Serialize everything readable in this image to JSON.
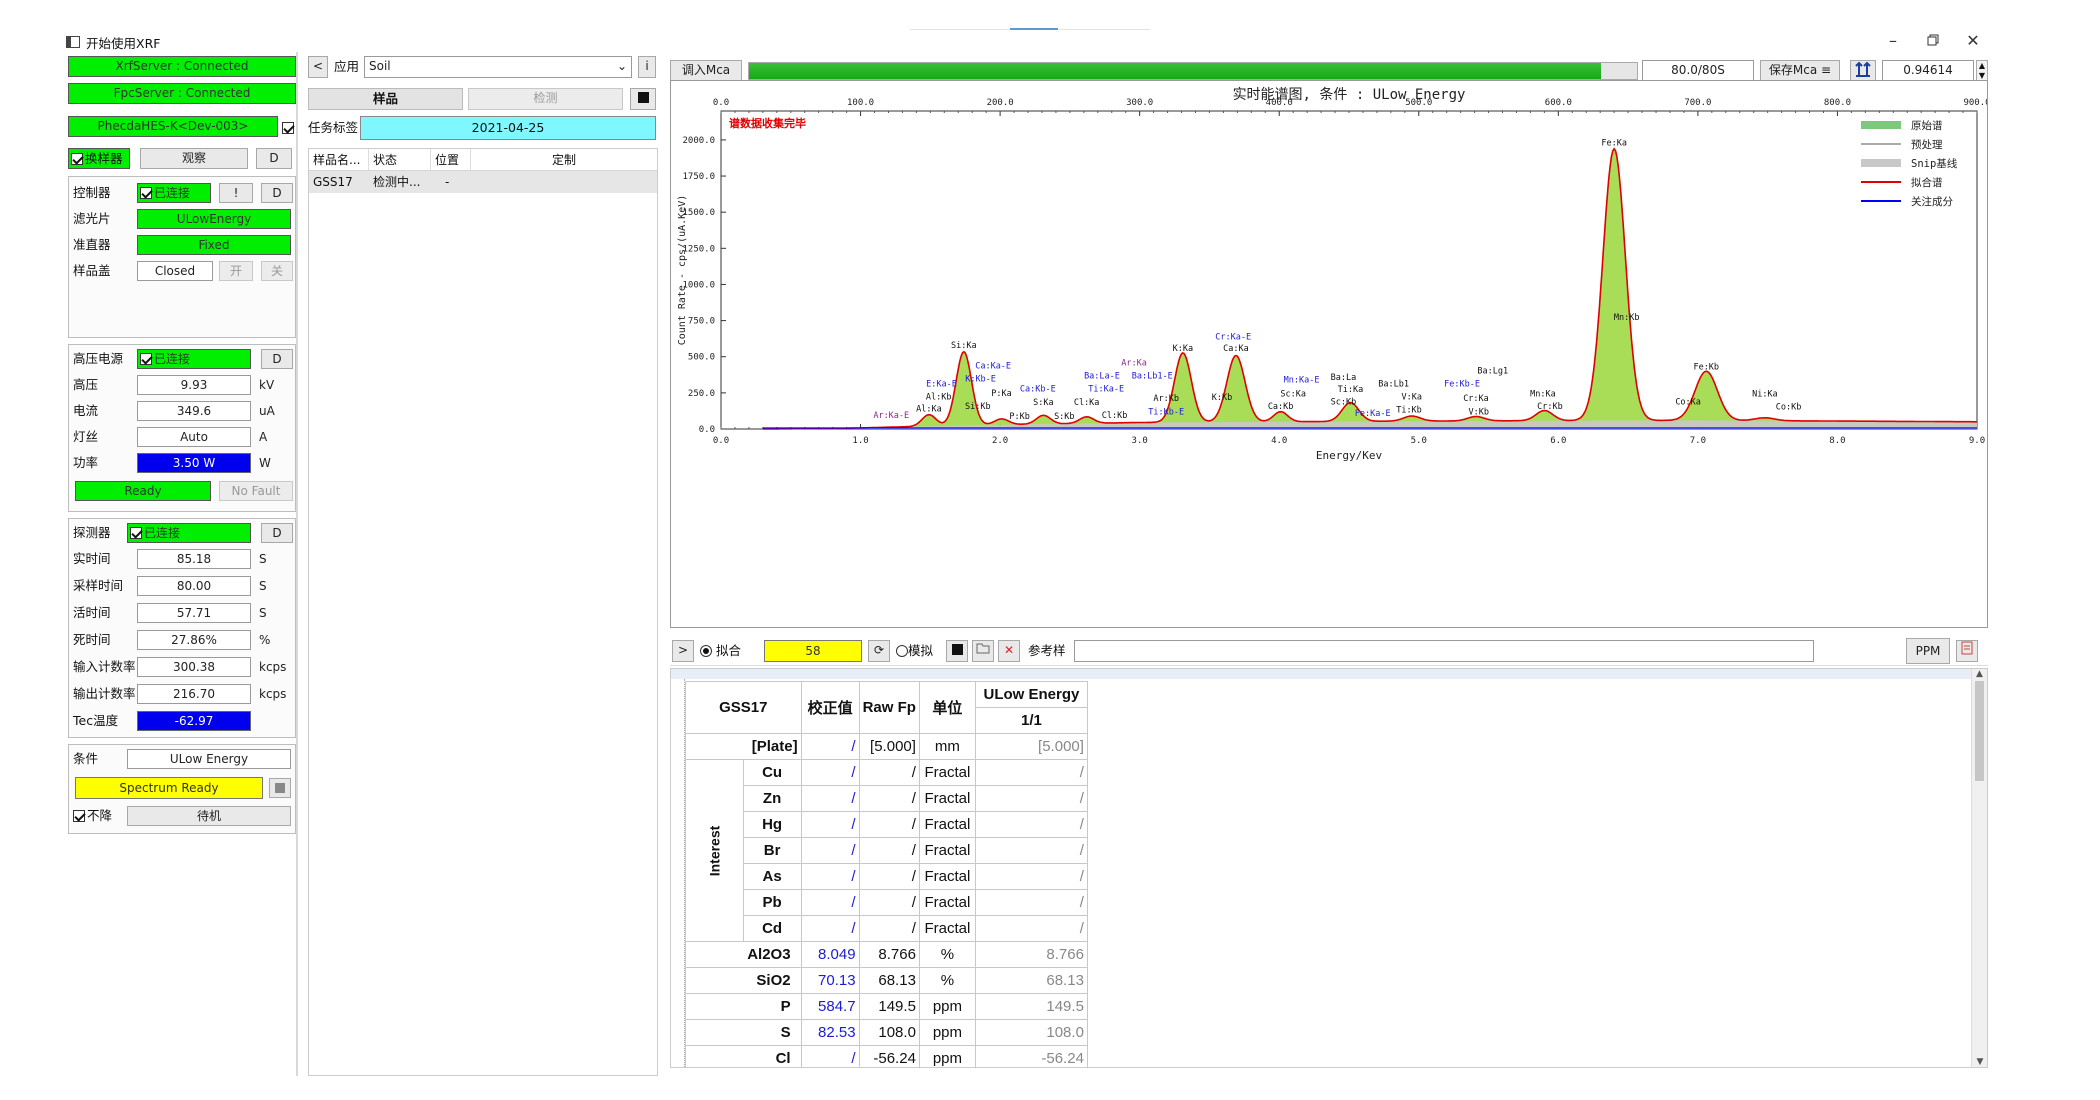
{
  "window": {
    "title": "开始使用XRF",
    "minimize_icon": "minimize-icon",
    "maximize_icon": "restore-icon",
    "close_icon": "close-icon"
  },
  "left": {
    "status": {
      "xrf": "XrfServer : Connected",
      "fpc": "FpcServer : Connected",
      "device": "PhecdaHES-K<Dev-003>"
    },
    "sample_changer": {
      "label": "换样器",
      "observe": "观察",
      "d": "D"
    },
    "controller": {
      "label": "控制器",
      "status": "已连接",
      "bang": "!",
      "d": "D"
    },
    "filter": {
      "label": "滤光片",
      "value": "ULowEnergy"
    },
    "collimator": {
      "label": "准直器",
      "value": "Fixed"
    },
    "sample_cover": {
      "label": "样品盖",
      "value": "Closed",
      "open": "开",
      "close": "关"
    },
    "hv": {
      "label": "高压电源",
      "status": "已连接",
      "d": "D"
    },
    "voltage": {
      "label": "高压",
      "value": "9.93",
      "unit": "kV"
    },
    "current": {
      "label": "电流",
      "value": "349.6",
      "unit": "uA"
    },
    "filament": {
      "label": "灯丝",
      "value": "Auto",
      "unit": "A"
    },
    "power": {
      "label": "功率",
      "value": "3.50 W",
      "unit": "W"
    },
    "ready": "Ready",
    "fault": "No Fault",
    "detector": {
      "label": "探测器",
      "status": "已连接",
      "d": "D"
    },
    "real_time": {
      "label": "实时间",
      "value": "85.18",
      "unit": "S"
    },
    "acq_time": {
      "label": "采样时间",
      "value": "80.00",
      "unit": "S"
    },
    "live_time": {
      "label": "活时间",
      "value": "57.71",
      "unit": "S"
    },
    "dead_time": {
      "label": "死时间",
      "value": "27.86%",
      "unit": "%"
    },
    "in_rate": {
      "label": "输入计数率",
      "value": "300.38",
      "unit": "kcps"
    },
    "out_rate": {
      "label": "输出计数率",
      "value": "216.70",
      "unit": "kcps"
    },
    "tec": {
      "label": "Tec温度",
      "value": "-62.97"
    },
    "condition": {
      "label": "条件",
      "value": "ULow Energy"
    },
    "spectrum_ready": "Spectrum Ready",
    "no_drop": "不降",
    "standby": "待机"
  },
  "middle": {
    "back": "<",
    "app_label": "应用",
    "app_value": "Soil",
    "info": "i",
    "sample_btn": "样品",
    "measure_btn": "检测",
    "task_label": "任务标签",
    "task_value": "2021-04-25",
    "columns": [
      "样品名...",
      "状态",
      "位置",
      "定制"
    ],
    "rows": [
      [
        "GSS17",
        "检测中...",
        "-",
        ""
      ]
    ]
  },
  "right": {
    "load_mca": "调入Mca",
    "progress": 0.96,
    "progress_text": "80.0/80S",
    "save_mca": "保存Mca",
    "save_mca_arrow": "≡",
    "value_box": "0.94614",
    "fit_label": "拟合",
    "fit_value": "58",
    "sim_label": "模拟",
    "ref_label": "参考样",
    "ppm": "PPM",
    "expand": ">"
  },
  "chart_data": {
    "type": "line",
    "title": "实时能谱图, 条件 : ULow Energy",
    "status_text": "谱数据收集完毕",
    "xlabel": "Energy/Kev",
    "ylabel": "Count Rate - cps/(uA.KeV)",
    "xlim": [
      0,
      9
    ],
    "ylim": [
      0,
      2200
    ],
    "top_axis_lim": [
      0,
      900
    ],
    "x_ticks": [
      "0.0",
      "1.0",
      "2.0",
      "3.0",
      "4.0",
      "5.0",
      "6.0",
      "7.0",
      "8.0",
      "9.0"
    ],
    "top_ticks": [
      "0.0",
      "100.0",
      "200.0",
      "300.0",
      "400.0",
      "500.0",
      "600.0",
      "700.0",
      "800.0",
      "900.0"
    ],
    "y_ticks": [
      "0.0",
      "250.0",
      "500.0",
      "750.0",
      "1000.0",
      "1250.0",
      "1500.0",
      "1750.0",
      "2000.0"
    ],
    "y_tick_values": [
      0,
      250,
      500,
      750,
      1000,
      1250,
      1500,
      1750,
      2000
    ],
    "legend": [
      "原始谱",
      "预处理",
      "Snip基线",
      "拟合谱",
      "关注成分"
    ],
    "legend_colors": [
      "#7ec87e",
      "#555555",
      "#c8c8c8",
      "#e00000",
      "#0000ff"
    ],
    "peaks": [
      {
        "e": 1.49,
        "h": 80,
        "w": 0.05
      },
      {
        "e": 1.74,
        "h": 510,
        "w": 0.055
      },
      {
        "e": 2.01,
        "h": 40,
        "w": 0.05
      },
      {
        "e": 2.31,
        "h": 60,
        "w": 0.05
      },
      {
        "e": 2.62,
        "h": 45,
        "w": 0.05
      },
      {
        "e": 3.31,
        "h": 480,
        "w": 0.06
      },
      {
        "e": 3.69,
        "h": 460,
        "w": 0.065
      },
      {
        "e": 4.01,
        "h": 70,
        "w": 0.05
      },
      {
        "e": 4.51,
        "h": 130,
        "w": 0.06
      },
      {
        "e": 4.95,
        "h": 35,
        "w": 0.06
      },
      {
        "e": 5.41,
        "h": 30,
        "w": 0.06
      },
      {
        "e": 5.9,
        "h": 70,
        "w": 0.06
      },
      {
        "e": 6.4,
        "h": 1880,
        "w": 0.08
      },
      {
        "e": 7.06,
        "h": 340,
        "w": 0.08
      },
      {
        "e": 7.48,
        "h": 20,
        "w": 0.07
      }
    ],
    "baseline": [
      [
        0.3,
        0
      ],
      [
        0.9,
        5
      ],
      [
        1.3,
        15
      ],
      [
        2.0,
        30
      ],
      [
        3.0,
        45
      ],
      [
        4.0,
        50
      ],
      [
        5.0,
        55
      ],
      [
        6.0,
        58
      ],
      [
        7.0,
        60
      ],
      [
        8.0,
        55
      ],
      [
        9.0,
        50
      ]
    ],
    "annotations": [
      {
        "t": "Si:Ka",
        "e": 1.74,
        "y": 560,
        "c": "#111"
      },
      {
        "t": "Ca:Ka-E",
        "e": 1.95,
        "y": 420,
        "c": "#1c1cd6"
      },
      {
        "t": "E:Ka-E",
        "e": 1.58,
        "y": 295,
        "c": "#1c1cd6"
      },
      {
        "t": "K:Kb-E",
        "e": 1.86,
        "y": 330,
        "c": "#1c1cd6"
      },
      {
        "t": "P:Ka",
        "e": 2.01,
        "y": 230,
        "c": "#111"
      },
      {
        "t": "Al:Kb",
        "e": 1.56,
        "y": 205,
        "c": "#111"
      },
      {
        "t": "Si:Kb",
        "e": 1.84,
        "y": 140,
        "c": "#111"
      },
      {
        "t": "Al:Ka",
        "e": 1.49,
        "y": 120,
        "c": "#111"
      },
      {
        "t": "Ar:Ka-E",
        "e": 1.22,
        "y": 75,
        "c": "#8a2a8a"
      },
      {
        "t": "P:Kb",
        "e": 2.14,
        "y": 70,
        "c": "#111"
      },
      {
        "t": "Ba:La-E",
        "e": 2.73,
        "y": 350,
        "c": "#1c1cd6"
      },
      {
        "t": "Ba:Lb1-E",
        "e": 3.09,
        "y": 350,
        "c": "#1c1cd6"
      },
      {
        "t": "Ar:Ka",
        "e": 2.96,
        "y": 440,
        "c": "#8a2a8a"
      },
      {
        "t": "Ca:Kb-E",
        "e": 2.27,
        "y": 260,
        "c": "#1c1cd6"
      },
      {
        "t": "Ti:Ka-E",
        "e": 2.76,
        "y": 260,
        "c": "#1c1cd6"
      },
      {
        "t": "S:Ka",
        "e": 2.31,
        "y": 165,
        "c": "#111"
      },
      {
        "t": "Cl:Ka",
        "e": 2.62,
        "y": 165,
        "c": "#111"
      },
      {
        "t": "S:Kb",
        "e": 2.46,
        "y": 70,
        "c": "#111"
      },
      {
        "t": "Cl:Kb",
        "e": 2.82,
        "y": 75,
        "c": "#111"
      },
      {
        "t": "K:Ka",
        "e": 3.31,
        "y": 540,
        "c": "#111"
      },
      {
        "t": "Ar:Kb",
        "e": 3.19,
        "y": 195,
        "c": "#111"
      },
      {
        "t": "Ti:Kb-E",
        "e": 3.19,
        "y": 100,
        "c": "#1c1cd6"
      },
      {
        "t": "K:Kb",
        "e": 3.59,
        "y": 200,
        "c": "#111"
      },
      {
        "t": "Cr:Ka-E",
        "e": 3.67,
        "y": 620,
        "c": "#1c1cd6"
      },
      {
        "t": "Ca:Ka",
        "e": 3.69,
        "y": 540,
        "c": "#111"
      },
      {
        "t": "Ca:Kb",
        "e": 4.01,
        "y": 140,
        "c": "#111"
      },
      {
        "t": "Mn:Ka-E",
        "e": 4.16,
        "y": 320,
        "c": "#1c1cd6"
      },
      {
        "t": "Sc:Ka",
        "e": 4.1,
        "y": 225,
        "c": "#111"
      },
      {
        "t": "Ba:La",
        "e": 4.46,
        "y": 340,
        "c": "#111"
      },
      {
        "t": "Ti:Ka",
        "e": 4.51,
        "y": 255,
        "c": "#111"
      },
      {
        "t": "Sc:Kb",
        "e": 4.46,
        "y": 170,
        "c": "#111"
      },
      {
        "t": "Fe:Ka-E",
        "e": 4.67,
        "y": 90,
        "c": "#1c1cd6"
      },
      {
        "t": "Ba:Lb1",
        "e": 4.82,
        "y": 295,
        "c": "#111"
      },
      {
        "t": "V:Ka",
        "e": 4.95,
        "y": 205,
        "c": "#111"
      },
      {
        "t": "Ti:Kb",
        "e": 4.93,
        "y": 115,
        "c": "#111"
      },
      {
        "t": "Fe:Kb-E",
        "e": 5.31,
        "y": 295,
        "c": "#1c1cd6"
      },
      {
        "t": "Ba:Lg1",
        "e": 5.53,
        "y": 385,
        "c": "#111"
      },
      {
        "t": "Cr:Ka",
        "e": 5.41,
        "y": 195,
        "c": "#111"
      },
      {
        "t": "V:Kb",
        "e": 5.43,
        "y": 100,
        "c": "#111"
      },
      {
        "t": "Mn:Ka",
        "e": 5.89,
        "y": 225,
        "c": "#111"
      },
      {
        "t": "Cr:Kb",
        "e": 5.94,
        "y": 140,
        "c": "#111"
      },
      {
        "t": "Fe:Ka",
        "e": 6.4,
        "y": 1960,
        "c": "#111"
      },
      {
        "t": "Mn:Kb",
        "e": 6.49,
        "y": 755,
        "c": "#111"
      },
      {
        "t": "Fe:Kb",
        "e": 7.06,
        "y": 410,
        "c": "#111"
      },
      {
        "t": "Co:Ka",
        "e": 6.93,
        "y": 170,
        "c": "#111"
      },
      {
        "t": "Ni:Ka",
        "e": 7.48,
        "y": 225,
        "c": "#111"
      },
      {
        "t": "Co:Kb",
        "e": 7.65,
        "y": 135,
        "c": "#111"
      }
    ]
  },
  "results": {
    "header": {
      "sample": "GSS17",
      "corr": "校正值",
      "rawfp": "Raw Fp",
      "unit": "单位",
      "cond": "ULow Energy",
      "cond_sub": "1/1"
    },
    "plate": {
      "name": "[Plate]",
      "corr": "/",
      "raw": "[5.000]",
      "unit": "mm",
      "val": "[5.000]"
    },
    "interest_label": "Interest",
    "interest": [
      {
        "el": "Cu",
        "corr": "/",
        "raw": "/",
        "unit": "Fractal",
        "val": "/"
      },
      {
        "el": "Zn",
        "corr": "/",
        "raw": "/",
        "unit": "Fractal",
        "val": "/"
      },
      {
        "el": "Hg",
        "corr": "/",
        "raw": "/",
        "unit": "Fractal",
        "val": "/"
      },
      {
        "el": "Br",
        "corr": "/",
        "raw": "/",
        "unit": "Fractal",
        "val": "/"
      },
      {
        "el": "As",
        "corr": "/",
        "raw": "/",
        "unit": "Fractal",
        "val": "/"
      },
      {
        "el": "Pb",
        "corr": "/",
        "raw": "/",
        "unit": "Fractal",
        "val": "/"
      },
      {
        "el": "Cd",
        "corr": "/",
        "raw": "/",
        "unit": "Fractal",
        "val": "/"
      }
    ],
    "others": [
      {
        "el": "Al2O3",
        "corr": "8.049",
        "raw": "8.766",
        "unit": "%",
        "val": "8.766"
      },
      {
        "el": "SiO2",
        "corr": "70.13",
        "raw": "68.13",
        "unit": "%",
        "val": "68.13"
      },
      {
        "el": "P",
        "corr": "584.7",
        "raw": "149.5",
        "unit": "ppm",
        "val": "149.5"
      },
      {
        "el": "S",
        "corr": "82.53",
        "raw": "108.0",
        "unit": "ppm",
        "val": "108.0"
      },
      {
        "el": "Cl",
        "corr": "/",
        "raw": "-56.24",
        "unit": "ppm",
        "val": "-56.24"
      }
    ]
  }
}
